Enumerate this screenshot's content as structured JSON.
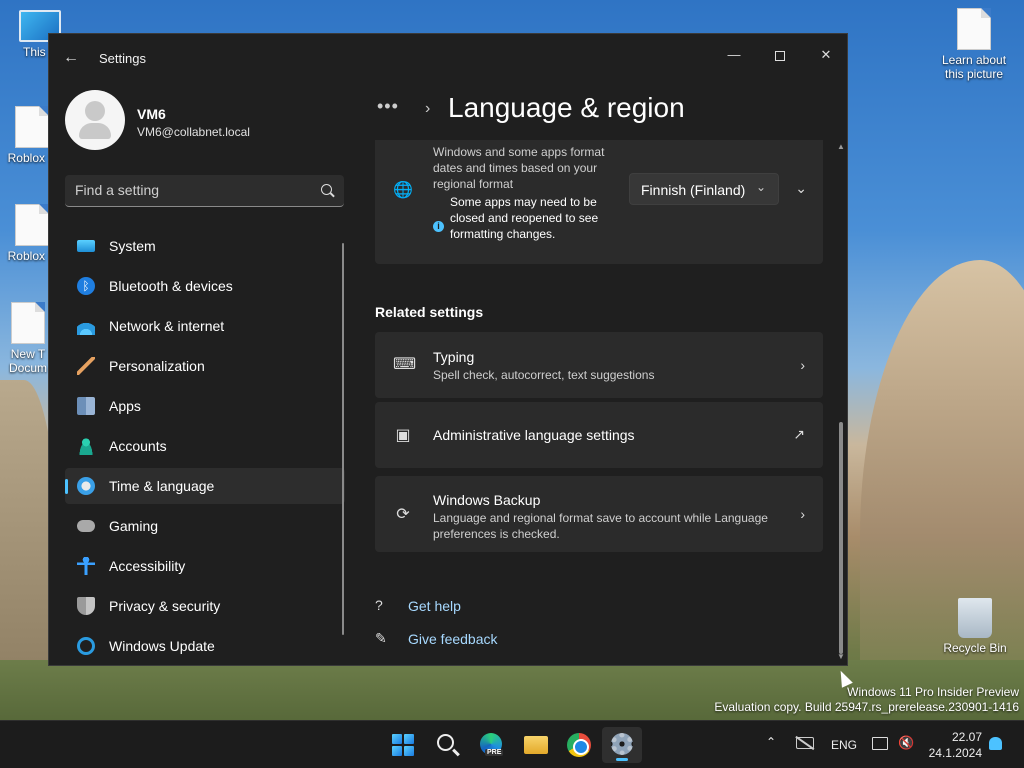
{
  "desktop": {
    "icons": [
      {
        "label": "This P"
      },
      {
        "label": "Roblox S"
      },
      {
        "label": "Roblox P"
      },
      {
        "label": "New T Docum"
      },
      {
        "label": "Learn about this picture"
      },
      {
        "label": "Recycle Bin"
      }
    ],
    "watermark": {
      "line1": "Windows 11 Pro Insider Preview",
      "line2": "Evaluation copy. Build 25947.rs_prerelease.230901-1416"
    }
  },
  "window": {
    "title": "Settings",
    "back_icon": "back-arrow-icon",
    "controls": {
      "minimize": "—",
      "close": "✕"
    }
  },
  "profile": {
    "name": "VM6",
    "email": "VM6@collabnet.local"
  },
  "search": {
    "placeholder": "Find a setting"
  },
  "nav": {
    "items": [
      {
        "label": "System",
        "icon": "system-icon"
      },
      {
        "label": "Bluetooth & devices",
        "icon": "bluetooth-icon"
      },
      {
        "label": "Network & internet",
        "icon": "network-icon"
      },
      {
        "label": "Personalization",
        "icon": "brush-icon"
      },
      {
        "label": "Apps",
        "icon": "apps-icon"
      },
      {
        "label": "Accounts",
        "icon": "accounts-icon"
      },
      {
        "label": "Time & language",
        "icon": "time-language-icon",
        "selected": true
      },
      {
        "label": "Gaming",
        "icon": "gamepad-icon"
      },
      {
        "label": "Accessibility",
        "icon": "accessibility-icon"
      },
      {
        "label": "Privacy & security",
        "icon": "shield-icon"
      },
      {
        "label": "Windows Update",
        "icon": "update-icon"
      }
    ]
  },
  "breadcrumb": {
    "more": "•••",
    "separator": "›",
    "title": "Language & region"
  },
  "regional_format": {
    "description": "Windows and some apps format dates and times based on your regional format",
    "note": "Some apps may need to be closed and reopened to see formatting changes.",
    "selected_value": "Finnish (Finland)"
  },
  "related": {
    "section_title": "Related settings",
    "typing": {
      "title": "Typing",
      "subtitle": "Spell check, autocorrect, text suggestions"
    },
    "admin": {
      "title": "Administrative language settings"
    },
    "backup": {
      "title": "Windows Backup",
      "subtitle": "Language and regional format save to account while Language preferences is checked."
    }
  },
  "help": {
    "get_help": "Get help",
    "give_feedback": "Give feedback"
  },
  "taskbar": {
    "apps": [
      "start",
      "search",
      "edge-pre",
      "file-explorer",
      "chrome",
      "settings"
    ],
    "edge_badge": "PRE",
    "tray": {
      "language": "ENG",
      "time": "22.07",
      "date": "24.1.2024"
    }
  },
  "colors": {
    "accent": "#4cc2ff",
    "window_bg": "#1f1f1f",
    "card_bg": "#2b2b2b",
    "link": "#a7d9ff"
  }
}
